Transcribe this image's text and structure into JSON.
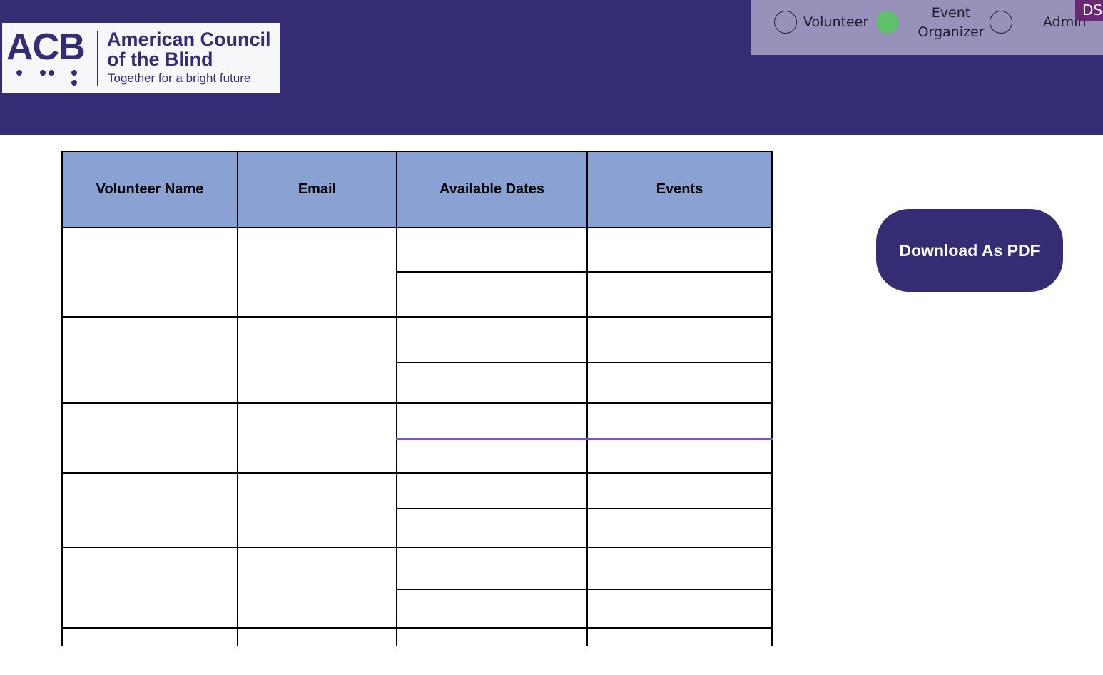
{
  "header": {
    "logo": {
      "abbr": "ACB",
      "org_line1": "American Council",
      "org_line2": "of the Blind",
      "tagline": "Together for a bright future"
    },
    "roles": [
      {
        "label": "Volunteer",
        "selected": false
      },
      {
        "label": "Event\nOrganizer",
        "selected": true
      },
      {
        "label": "Admin",
        "selected": false
      }
    ],
    "user_badge": "DS"
  },
  "table": {
    "columns": [
      "Volunteer Name",
      "Email",
      "Available Dates",
      "Events"
    ]
  },
  "actions": {
    "download_pdf": "Download As PDF"
  },
  "colors": {
    "brand": "#342d74",
    "role_bar": "#9892bb",
    "selected": "#5ebf6c",
    "table_header": "#89a1d3",
    "highlight_line": "#7b4fd6"
  }
}
